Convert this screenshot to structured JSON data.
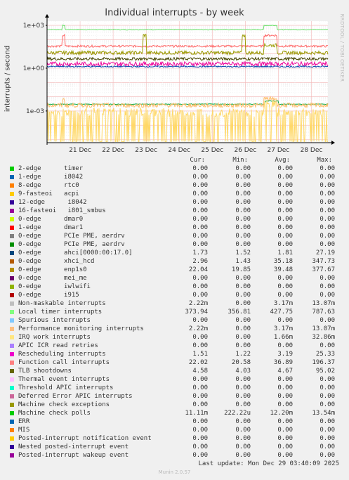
{
  "title": "Individual interrupts - by week",
  "watermark": "RRDTOOL / TOBI OETIKER",
  "footer": {
    "last_update": "Last update: Mon Dec 29 03:40:09 2025",
    "version": "Munin 2.0.57"
  },
  "legend_headers": [
    "Cur:",
    "Min:",
    "Avg:",
    "Max:"
  ],
  "chart_data": {
    "type": "line",
    "title": "Individual interrupts - by week",
    "ylabel": "interrupts / second",
    "yscale": "log",
    "ylim": [
      6e-06,
      2000
    ],
    "yticks": [
      {
        "value": 1000,
        "label": "1e+03"
      },
      {
        "value": 1,
        "label": "1e+00"
      },
      {
        "value": 0.001,
        "label": "1e-03"
      }
    ],
    "xlim": [
      0,
      8.5
    ],
    "xticks": [
      {
        "value": 1,
        "label": "21 Dec"
      },
      {
        "value": 2,
        "label": "22 Dec"
      },
      {
        "value": 3,
        "label": "23 Dec"
      },
      {
        "value": 4,
        "label": "24 Dec"
      },
      {
        "value": 5,
        "label": "25 Dec"
      },
      {
        "value": 6,
        "label": "26 Dec"
      },
      {
        "value": 7,
        "label": "27 Dec"
      },
      {
        "value": 8,
        "label": "28 Dec"
      }
    ],
    "grid": true,
    "series": [
      {
        "name": "Local timer interrupts",
        "color": "#66dd66",
        "level": 500,
        "noise": 0.05,
        "events": [
          [
            0.45,
            0.55,
            1000
          ],
          [
            6.55,
            6.95,
            1000
          ]
        ]
      },
      {
        "name": "Function call interrupts",
        "color": "#ff6666",
        "level": 35,
        "noise": 0.15,
        "events": [
          [
            0.45,
            0.55,
            200
          ],
          [
            6.55,
            6.95,
            200
          ]
        ]
      },
      {
        "name": "Machine check polls",
        "color": "#999900",
        "level": 12,
        "noise": 0.25,
        "events": [
          [
            2.9,
            3.0,
            200
          ],
          [
            5.9,
            6.0,
            200
          ],
          [
            6.55,
            6.95,
            40
          ]
        ]
      },
      {
        "name": "TLB shootdowns",
        "color": "#444400",
        "level": 4.5,
        "noise": 0.2,
        "events": []
      },
      {
        "name": "Rescheduling interrupts",
        "color": "#ee0099",
        "level": 2,
        "noise": 0.3,
        "events": []
      },
      {
        "name": "ahci[0000:00:17.0]",
        "color": "#0044aa",
        "level": 1.3,
        "noise": 0.1,
        "events": []
      },
      {
        "name": "Non-maskable interrupts",
        "color": "#00aa44",
        "level": 0.003,
        "noise": 0.05,
        "events": [
          [
            6.6,
            7.0,
            0.005
          ]
        ]
      },
      {
        "name": "Performance monitoring interrupts",
        "color": "#ffbb66",
        "level": 0.0025,
        "noise": 0.3,
        "events": [
          [
            0.45,
            0.55,
            0.006
          ],
          [
            6.55,
            6.95,
            0.007
          ]
        ]
      },
      {
        "name": "IRQ work interrupts",
        "color": "#ffd866",
        "level": 0.0008,
        "noise": 0.6,
        "events": [
          [
            6.55,
            6.95,
            0.003
          ]
        ]
      }
    ]
  },
  "legend": [
    {
      "name": "2-edge      timer",
      "color": "#00cc00",
      "cur": "0.00",
      "min": "0.00",
      "avg": "0.00",
      "max": "0.00"
    },
    {
      "name": "1-edge      i8042",
      "color": "#0066b3",
      "cur": "0.00",
      "min": "0.00",
      "avg": "0.00",
      "max": "0.00"
    },
    {
      "name": "8-edge      rtc0",
      "color": "#ff8000",
      "cur": "0.00",
      "min": "0.00",
      "avg": "0.00",
      "max": "0.00"
    },
    {
      "name": "9-fasteoi   acpi",
      "color": "#ffcc00",
      "cur": "0.00",
      "min": "0.00",
      "avg": "0.00",
      "max": "0.00"
    },
    {
      "name": "12-edge      i8042",
      "color": "#330099",
      "cur": "0.00",
      "min": "0.00",
      "avg": "0.00",
      "max": "0.00"
    },
    {
      "name": "16-fasteoi   i801_smbus",
      "color": "#990099",
      "cur": "0.00",
      "min": "0.00",
      "avg": "0.00",
      "max": "0.00"
    },
    {
      "name": "0-edge      dmar0",
      "color": "#ccff00",
      "cur": "0.00",
      "min": "0.00",
      "avg": "0.00",
      "max": "0.00"
    },
    {
      "name": "1-edge      dmar1",
      "color": "#ff0000",
      "cur": "0.00",
      "min": "0.00",
      "avg": "0.00",
      "max": "0.00"
    },
    {
      "name": "0-edge      PCIe PME, aerdrv",
      "color": "#808080",
      "cur": "0.00",
      "min": "0.00",
      "avg": "0.00",
      "max": "0.00"
    },
    {
      "name": "0-edge      PCIe PME, aerdrv",
      "color": "#008f00",
      "cur": "0.00",
      "min": "0.00",
      "avg": "0.00",
      "max": "0.00"
    },
    {
      "name": "0-edge      ahci[0000:00:17.0]",
      "color": "#00487d",
      "cur": "1.73",
      "min": "1.52",
      "avg": "1.81",
      "max": "27.19"
    },
    {
      "name": "0-edge      xhci_hcd",
      "color": "#b35a00",
      "cur": "2.96",
      "min": "1.43",
      "avg": "35.18",
      "max": "347.73"
    },
    {
      "name": "0-edge      enp1s0",
      "color": "#b38f00",
      "cur": "22.04",
      "min": "19.85",
      "avg": "39.48",
      "max": "377.67"
    },
    {
      "name": "0-edge      mei_me",
      "color": "#6b006b",
      "cur": "0.00",
      "min": "0.00",
      "avg": "0.00",
      "max": "0.00"
    },
    {
      "name": "0-edge      iwlwifi",
      "color": "#8fb300",
      "cur": "0.00",
      "min": "0.00",
      "avg": "0.00",
      "max": "0.00"
    },
    {
      "name": "0-edge      i915",
      "color": "#b30000",
      "cur": "0.00",
      "min": "0.00",
      "avg": "0.00",
      "max": "0.00"
    },
    {
      "name": "Non-maskable interrupts",
      "color": "#bebebe",
      "cur": "2.22m",
      "min": "0.00",
      "avg": "3.17m",
      "max": "13.07m"
    },
    {
      "name": "Local timer interrupts",
      "color": "#80ff80",
      "cur": "373.94",
      "min": "356.81",
      "avg": "427.75",
      "max": "787.63"
    },
    {
      "name": "Spurious interrupts",
      "color": "#80c9ff",
      "cur": "0.00",
      "min": "0.00",
      "avg": "0.00",
      "max": "0.00"
    },
    {
      "name": "Performance monitoring interrupts",
      "color": "#ffc080",
      "cur": "2.22m",
      "min": "0.00",
      "avg": "3.17m",
      "max": "13.07m"
    },
    {
      "name": "IRQ work interrupts",
      "color": "#ffe680",
      "cur": "0.00",
      "min": "0.00",
      "avg": "1.66m",
      "max": "32.86m"
    },
    {
      "name": "APIC ICR read retries",
      "color": "#aa80ff",
      "cur": "0.00",
      "min": "0.00",
      "avg": "0.00",
      "max": "0.00"
    },
    {
      "name": "Rescheduling interrupts",
      "color": "#ee00cc",
      "cur": "1.51",
      "min": "1.22",
      "avg": "3.19",
      "max": "25.33"
    },
    {
      "name": "Function call interrupts",
      "color": "#ff8080",
      "cur": "22.02",
      "min": "20.58",
      "avg": "36.89",
      "max": "196.37"
    },
    {
      "name": "TLB shootdowns",
      "color": "#666600",
      "cur": "4.58",
      "min": "4.03",
      "avg": "4.67",
      "max": "95.02"
    },
    {
      "name": "Thermal event interrupts",
      "color": "#ffbfff",
      "cur": "0.00",
      "min": "0.00",
      "avg": "0.00",
      "max": "0.00"
    },
    {
      "name": "Threshold APIC interrupts",
      "color": "#00ffcc",
      "cur": "0.00",
      "min": "0.00",
      "avg": "0.00",
      "max": "0.00"
    },
    {
      "name": "Deferred Error APIC interrupts",
      "color": "#cc6699",
      "cur": "0.00",
      "min": "0.00",
      "avg": "0.00",
      "max": "0.00"
    },
    {
      "name": "Machine check exceptions",
      "color": "#999900",
      "cur": "0.00",
      "min": "0.00",
      "avg": "0.00",
      "max": "0.00"
    },
    {
      "name": "Machine check polls",
      "color": "#00cc00",
      "cur": "11.11m",
      "min": "222.22u",
      "avg": "12.20m",
      "max": "13.54m"
    },
    {
      "name": "ERR",
      "color": "#0066b3",
      "cur": "0.00",
      "min": "0.00",
      "avg": "0.00",
      "max": "0.00"
    },
    {
      "name": "MIS",
      "color": "#ff8000",
      "cur": "0.00",
      "min": "0.00",
      "avg": "0.00",
      "max": "0.00"
    },
    {
      "name": "Posted-interrupt notification event",
      "color": "#ffcc00",
      "cur": "0.00",
      "min": "0.00",
      "avg": "0.00",
      "max": "0.00"
    },
    {
      "name": "Nested posted-interrupt event",
      "color": "#330099",
      "cur": "0.00",
      "min": "0.00",
      "avg": "0.00",
      "max": "0.00"
    },
    {
      "name": "Posted-interrupt wakeup event",
      "color": "#990099",
      "cur": "0.00",
      "min": "0.00",
      "avg": "0.00",
      "max": "0.00"
    }
  ]
}
